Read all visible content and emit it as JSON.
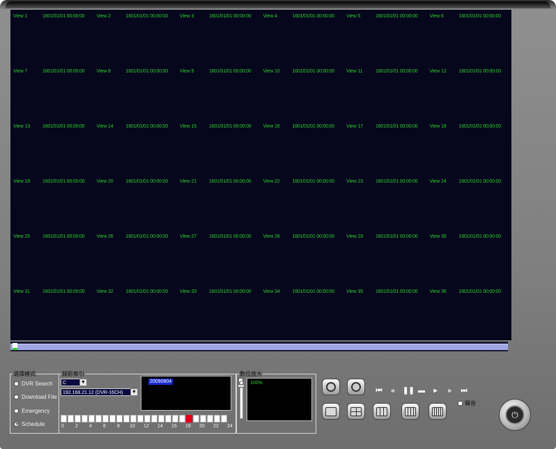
{
  "views": [
    {
      "name": "View 1",
      "time": "1601/01/01 00:00:00"
    },
    {
      "name": "View 2",
      "time": "1601/01/01 00:00:00"
    },
    {
      "name": "View 3",
      "time": "1601/01/01 00:00:00"
    },
    {
      "name": "View 4",
      "time": "1601/01/01 00:00:00"
    },
    {
      "name": "View 5",
      "time": "1601/01/01 00:00:00"
    },
    {
      "name": "View 6",
      "time": "1601/01/01 00:00:00"
    },
    {
      "name": "View 7",
      "time": "1601/01/01 00:00:00"
    },
    {
      "name": "View 8",
      "time": "1601/01/01 00:00:00"
    },
    {
      "name": "View 9",
      "time": "1601/01/01 00:00:00"
    },
    {
      "name": "View 10",
      "time": "1601/01/01 00:00:00"
    },
    {
      "name": "View 11",
      "time": "1601/01/01 00:00:00"
    },
    {
      "name": "View 12",
      "time": "1601/01/01 00:00:00"
    },
    {
      "name": "View 13",
      "time": "1601/01/01 00:00:00"
    },
    {
      "name": "View 14",
      "time": "1601/01/01 00:00:00"
    },
    {
      "name": "View 15",
      "time": "1601/01/01 00:00:00"
    },
    {
      "name": "View 16",
      "time": "1601/01/01 00:00:00"
    },
    {
      "name": "View 17",
      "time": "1601/01/01 00:00:00"
    },
    {
      "name": "View 18",
      "time": "1601/01/01 00:00:00"
    },
    {
      "name": "View 19",
      "time": "1601/01/01 00:00:00"
    },
    {
      "name": "View 20",
      "time": "1601/01/01 00:00:00"
    },
    {
      "name": "View 21",
      "time": "1601/01/01 00:00:00"
    },
    {
      "name": "View 22",
      "time": "1601/01/01 00:00:00"
    },
    {
      "name": "View 23",
      "time": "1601/01/01 00:00:00"
    },
    {
      "name": "View 24",
      "time": "1601/01/01 00:00:00"
    },
    {
      "name": "View 25",
      "time": "1601/01/01 00:00:00"
    },
    {
      "name": "View 26",
      "time": "1601/01/01 00:00:00"
    },
    {
      "name": "View 27",
      "time": "1601/01/01 00:00:00"
    },
    {
      "name": "View 28",
      "time": "1601/01/01 00:00:00"
    },
    {
      "name": "View 29",
      "time": "1601/01/01 00:00:00"
    },
    {
      "name": "View 30",
      "time": "1601/01/01 00:00:00"
    },
    {
      "name": "View 31",
      "time": "1601/01/01 00:00:00"
    },
    {
      "name": "View 32",
      "time": "1601/01/01 00:00:00"
    },
    {
      "name": "View 33",
      "time": "1601/01/01 00:00:00"
    },
    {
      "name": "View 34",
      "time": "1601/01/01 00:00:00"
    },
    {
      "name": "View 35",
      "time": "1601/01/01 00:00:00"
    },
    {
      "name": "View 36",
      "time": "1601/01/01 00:00:00"
    }
  ],
  "mode_group": {
    "legend": "選擇模式",
    "options": [
      {
        "label": "DVR Search",
        "selected": false
      },
      {
        "label": "Download File",
        "selected": false
      },
      {
        "label": "Emergency",
        "selected": false
      },
      {
        "label": "Schedule",
        "selected": true
      }
    ]
  },
  "record_group": {
    "legend": "錄影索引",
    "drive_value": "C",
    "device_value": "192.168.21.12 (DVR-16CH)",
    "dates": [
      "20090804"
    ],
    "hour_labels": [
      "0",
      "2",
      "4",
      "6",
      "8",
      "10",
      "12",
      "14",
      "16",
      "18",
      "20",
      "22",
      "24"
    ],
    "selected_hour": 18
  },
  "zoom_group": {
    "legend": "數位放大",
    "value": "100%"
  },
  "playback_controls": [
    "stop-icon",
    "rewind-icon",
    "pause-icon",
    "step-icon",
    "play-icon",
    "fast-forward-icon",
    "next-frame-icon"
  ],
  "audio_label": "聲音",
  "colors": {
    "overlay_text": "#2fd02f",
    "screen_bg": "#06061c",
    "timeline": "#9fa6e4",
    "hour_selected": "#e0001a"
  }
}
